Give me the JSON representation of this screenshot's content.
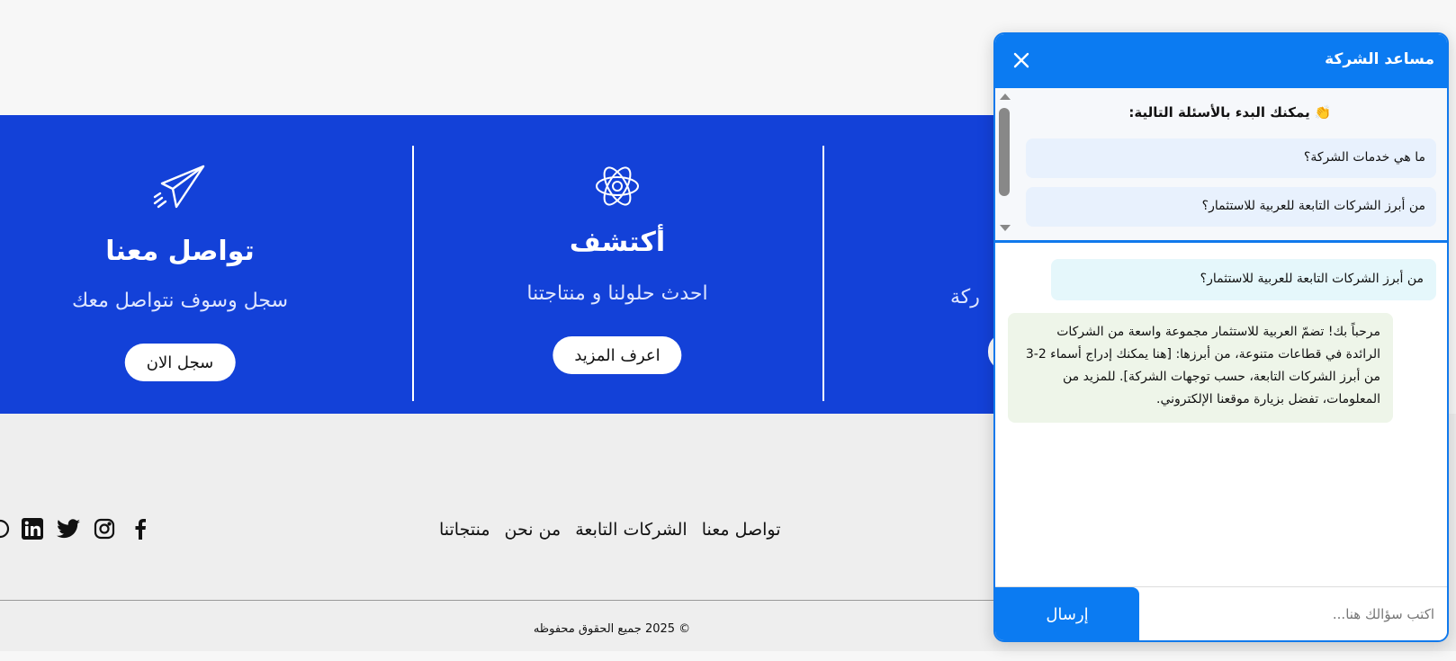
{
  "cards": [
    {
      "title": "تواصل معنا",
      "text": "سجل وسوف نتواصل معك",
      "button": "سجل الان",
      "icon": "paper-plane-icon"
    },
    {
      "title": "أكتشف",
      "text": "احدث حلولنا و منتاجتنا",
      "button": "اعرف المزيد",
      "icon": "atom-idea-icon"
    }
  ],
  "partial_card": {
    "text_fragment": "ركة"
  },
  "footer": {
    "nav": [
      "منتجاتنا",
      "من نحن",
      "الشركات التابعة",
      "تواصل معنا"
    ],
    "socials": [
      "facebook-icon",
      "instagram-icon",
      "twitter-icon",
      "linkedin-icon",
      "whatsapp-icon"
    ],
    "copyright": "© 2025 جميع الحقوق محفوظه"
  },
  "chat": {
    "title": "مساعد الشركة",
    "suggestions_title": "👏 يمكنك البدء بالأسئلة التالية:",
    "suggestions": [
      "ما هي خدمات الشركة؟",
      "من أبرز الشركات التابعة للعربية للاستثمار؟"
    ],
    "messages": [
      {
        "role": "user",
        "text": "من أبرز الشركات التابعة للعربية للاستثمار؟"
      },
      {
        "role": "bot",
        "text": "مرحباً بك! تضمّ العربية للاستثمار مجموعة واسعة من الشركات الرائدة في قطاعات متنوعة، من أبرزها: [هنا يمكنك إدراج أسماء 2-3 من أبرز الشركات التابعة، حسب توجهات الشركة]. للمزيد من المعلومات، تفضل بزيارة موقعنا الإلكتروني."
      }
    ],
    "input_placeholder": "اكتب سؤالك هنا...",
    "send_label": "إرسال"
  },
  "colors": {
    "band": "#1341d8",
    "chat_accent": "#0b7bf2"
  }
}
